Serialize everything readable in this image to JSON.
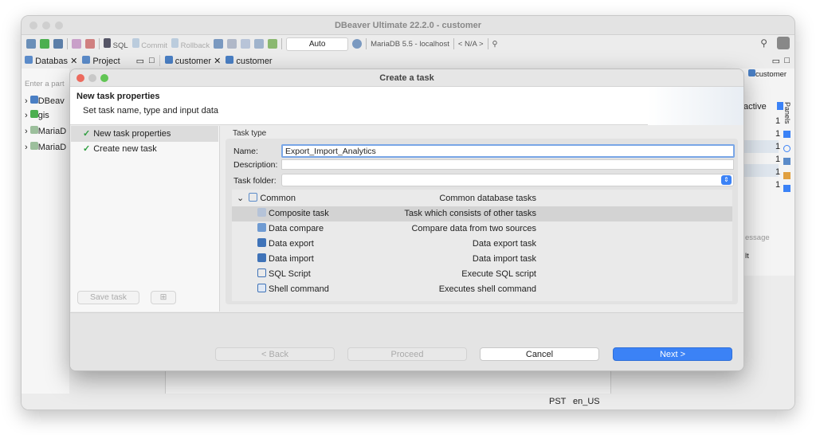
{
  "window": {
    "title": "DBeaver Ultimate 22.2.0 - customer"
  },
  "toolbar": {
    "sql_label": "SQL",
    "commit_label": "Commit",
    "rollback_label": "Rollback",
    "transaction_mode": "Auto",
    "connection": "MariaDB 5.5 - localhost",
    "schema": "< N/A >"
  },
  "tabs": {
    "database": "Databas",
    "project": "Project",
    "customer1": "customer",
    "customer2": "customer",
    "right_customer": "customer"
  },
  "navigator": {
    "filter_placeholder": "Enter a part",
    "items": [
      "DBeav",
      "gis",
      "MariaD",
      "MariaD"
    ]
  },
  "right_panel": {
    "active_label": "active",
    "panels_label": "Panels",
    "values": [
      "1",
      "1",
      "1",
      "1",
      "1",
      "1"
    ],
    "message_label": "essage",
    "lt_label": "lt"
  },
  "statusbar": {
    "timezone": "PST",
    "locale": "en_US"
  },
  "dialog": {
    "title": "Create a task",
    "header_title": "New task properties",
    "header_subtitle": "Set task name, type and input data",
    "steps": [
      "New task properties",
      "Create new task"
    ],
    "save_task_label": "Save task",
    "task_type_label": "Task type",
    "name_label": "Name:",
    "name_value": "Export_Import_Analytics",
    "description_label": "Description:",
    "description_value": "",
    "folder_label": "Task folder:",
    "folder_value": "",
    "tree": {
      "group_name": "Common",
      "group_desc": "Common database tasks",
      "items": [
        {
          "name": "Composite task",
          "desc": "Task which consists of other tasks"
        },
        {
          "name": "Data compare",
          "desc": "Compare data from two sources"
        },
        {
          "name": "Data export",
          "desc": "Data export task"
        },
        {
          "name": "Data import",
          "desc": "Data import task"
        },
        {
          "name": "SQL Script",
          "desc": "Execute SQL script"
        },
        {
          "name": "Shell command",
          "desc": "Executes shell command"
        }
      ]
    },
    "buttons": {
      "back": "< Back",
      "proceed": "Proceed",
      "cancel": "Cancel",
      "next": "Next >"
    }
  },
  "colors": {
    "accent": "#3b82f6",
    "check": "#2e9e3f",
    "selection": "#d3d3d3"
  }
}
